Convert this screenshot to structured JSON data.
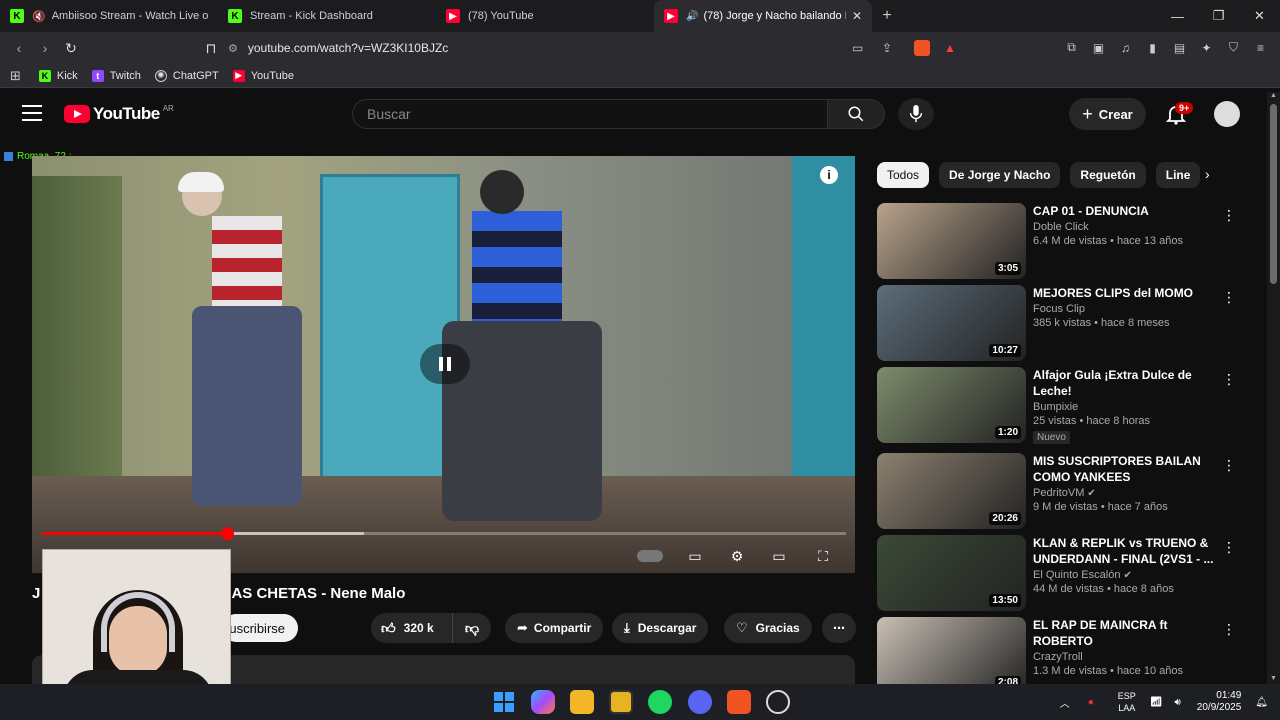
{
  "browser": {
    "tabs": [
      {
        "label": "Ambiisoo Stream - Watch Live on",
        "icon": "kick-icon",
        "muted": true
      },
      {
        "label": "Stream - Kick Dashboard",
        "icon": "kick-icon"
      },
      {
        "label": "(78) YouTube",
        "icon": "youtube-icon"
      },
      {
        "label": "(78) Jorge y Nacho bailando R",
        "icon": "youtube-icon",
        "active": true
      }
    ],
    "url": "youtube.com/watch?v=WZ3KI10BJZc",
    "bookmarks": [
      {
        "label": "Kick",
        "icon": "kick-icon"
      },
      {
        "label": "Twitch",
        "icon": "twitch-icon"
      },
      {
        "label": "ChatGPT",
        "icon": "chatgpt-icon"
      },
      {
        "label": "YouTube",
        "icon": "youtube-icon"
      }
    ]
  },
  "youtube": {
    "logo_text": "YouTube",
    "country": "AR",
    "search_placeholder": "Buscar",
    "create_label": "Crear",
    "notif_badge": "9+"
  },
  "player": {
    "progress_fraction": 0.23,
    "buffered_fraction": 0.4,
    "chat_overlay_name": "Romaa_72 :"
  },
  "video": {
    "title": "J                 BAILAN LAS ROCHAS Y LAS CHETAS - Nene Malo",
    "subscribe_label": "uscribirse",
    "likes": "320 k",
    "share_label": "Compartir",
    "download_label": "Descargar",
    "thanks_label": "Gracias"
  },
  "chips": [
    "Todos",
    "De Jorge y Nacho",
    "Reguetón",
    "Line"
  ],
  "recommendations": [
    {
      "title": "CAP 01 - DENUNCIA",
      "channel": "Doble Click",
      "meta": "6.4 M de vistas • hace 13 años",
      "duration": "3:05",
      "color": "#b9a38c"
    },
    {
      "title": "MEJORES CLIPS del MOMO",
      "channel": "Focus Clip",
      "meta": "385 k vistas • hace 8 meses",
      "duration": "10:27",
      "color": "#5c6d7a"
    },
    {
      "title": "Alfajor Gula ¡Extra Dulce de Leche!",
      "channel": "Bumpixie",
      "meta": "25 vistas • hace 8 horas",
      "duration": "1:20",
      "badge": "Nuevo",
      "color": "#7d8c6c"
    },
    {
      "title": "MIS SUSCRIPTORES BAILAN COMO YANKEES",
      "channel": "PedritoVM",
      "meta": "9 M de vistas • hace 7 años",
      "duration": "20:26",
      "verified": true,
      "color": "#8d8170"
    },
    {
      "title": "KLAN & REPLIK vs TRUENO & UNDERDANN - FINAL (2VS1 - ...",
      "channel": "El Quinto Escalón",
      "meta": "44 M de vistas • hace 8 años",
      "duration": "13:50",
      "verified": true,
      "color": "#3b4a36"
    },
    {
      "title": "EL RAP DE MAINCRA ft ROBERTO",
      "channel": "CrazyTroll",
      "meta": "1.3 M de vistas • hace 10 años",
      "duration": "2:08",
      "color": "#c9bfb4"
    }
  ],
  "taskbar": {
    "lang_top": "ESP",
    "lang_bottom": "LAA",
    "time": "01:49",
    "date": "20/9/2025"
  }
}
